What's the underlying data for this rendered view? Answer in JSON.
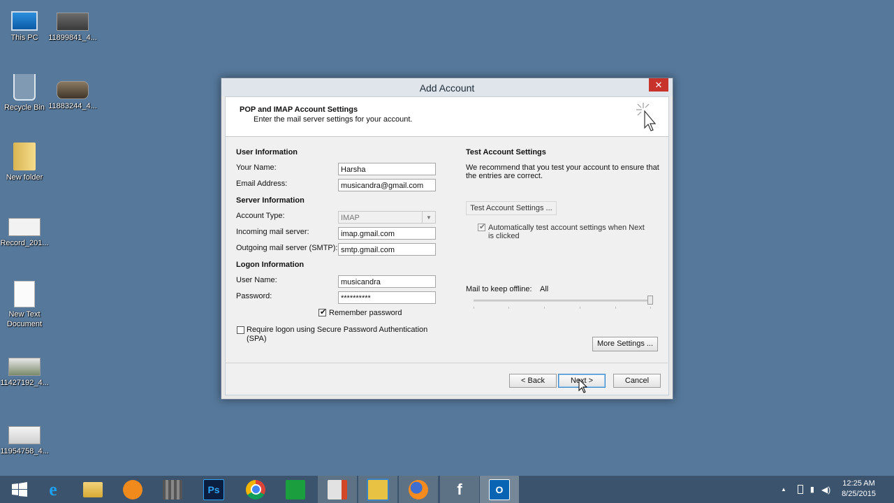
{
  "desktop": {
    "icons": [
      {
        "label": "This PC",
        "icon": "this-pc-icon"
      },
      {
        "label": "11899841_4...",
        "icon": "image-file-icon"
      },
      {
        "label": "Recycle Bin",
        "icon": "recycle-bin-icon"
      },
      {
        "label": "11883244_4...",
        "icon": "image-file-icon"
      },
      {
        "label": "New folder",
        "icon": "folder-icon"
      },
      {
        "label": "Record_201...",
        "icon": "video-file-icon"
      },
      {
        "label": "New Text",
        "label2": "Document",
        "icon": "text-document-icon"
      },
      {
        "label": "11427192_4...",
        "icon": "image-file-icon"
      },
      {
        "label": "11954758_4...",
        "icon": "image-file-icon"
      }
    ]
  },
  "dialog": {
    "title": "Add Account",
    "close": "✕",
    "header_title": "POP and IMAP Account Settings",
    "header_subtitle": "Enter the mail server settings for your account.",
    "user_info": {
      "heading": "User Information",
      "name_label": "Your Name:",
      "name_value": "Harsha",
      "email_label": "Email Address:",
      "email_value": "musicandra@gmail.com"
    },
    "server_info": {
      "heading": "Server Information",
      "account_type_label": "Account Type:",
      "account_type_value": "IMAP",
      "incoming_label": "Incoming mail server:",
      "incoming_value": "imap.gmail.com",
      "outgoing_label": "Outgoing mail server (SMTP):",
      "outgoing_value": "smtp.gmail.com"
    },
    "logon_info": {
      "heading": "Logon Information",
      "username_label": "User Name:",
      "username_value": "musicandra",
      "password_label": "Password:",
      "password_value": "**********",
      "remember_label": "Remember password",
      "spa_label_line1": "Require logon using Secure Password Authentication",
      "spa_label_line2": "(SPA)"
    },
    "test_settings": {
      "heading": "Test Account Settings",
      "desc_line1": "We recommend that you test your account to ensure that",
      "desc_line2": "the entries are correct.",
      "test_button": "Test Account Settings ...",
      "auto_test_line1": "Automatically test account settings when Next",
      "auto_test_line2": "is clicked",
      "offline_label": "Mail to keep offline:",
      "offline_value": "All",
      "offline_level": 1.0,
      "more_settings": "More Settings ..."
    },
    "footer": {
      "back": "< Back",
      "next": "Next >",
      "cancel": "Cancel"
    }
  },
  "taskbar": {
    "apps": [
      {
        "name": "start-button",
        "glyph": ""
      },
      {
        "name": "internet-explorer",
        "glyph": "e"
      },
      {
        "name": "file-explorer",
        "glyph": ""
      },
      {
        "name": "uc-browser",
        "glyph": ""
      },
      {
        "name": "video-app",
        "glyph": ""
      },
      {
        "name": "photoshop",
        "glyph": "Ps"
      },
      {
        "name": "chrome",
        "glyph": ""
      },
      {
        "name": "store",
        "glyph": ""
      },
      {
        "name": "office",
        "glyph": ""
      },
      {
        "name": "file-manager",
        "glyph": ""
      },
      {
        "name": "firefox",
        "glyph": ""
      },
      {
        "name": "facebook",
        "glyph": "f"
      },
      {
        "name": "outlook",
        "glyph": "O"
      }
    ],
    "clock_time": "12:25 AM",
    "clock_date": "8/25/2015"
  }
}
